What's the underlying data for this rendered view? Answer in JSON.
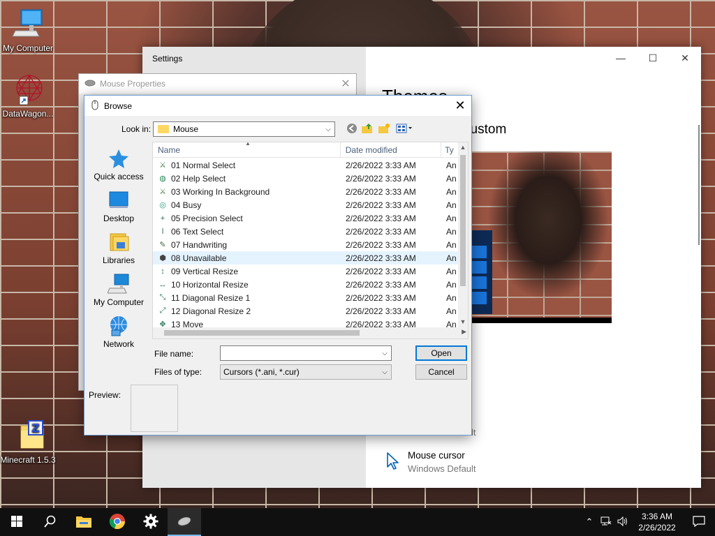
{
  "desktop": {
    "icons": [
      {
        "label": "My Computer",
        "icon": "computer-icon"
      },
      {
        "label": "DataWagon...",
        "icon": "datawagon-shortcut-icon"
      },
      {
        "label": "Minecraft 1.5.3",
        "icon": "minecraft-zip-icon"
      }
    ]
  },
  "settings": {
    "title": "Settings",
    "theme_heading": "Themes",
    "theme_current": "t: Custom",
    "faded_label": "Windows Default",
    "mouse_cursor_title": "Mouse cursor",
    "mouse_cursor_value": "Windows Default"
  },
  "mouse_properties": {
    "title": "Mouse Properties"
  },
  "browse": {
    "title": "Browse",
    "look_in_label": "Look in:",
    "look_in_value": "Mouse",
    "places": [
      {
        "label": "Quick access",
        "icon": "quick-access-star-icon"
      },
      {
        "label": "Desktop",
        "icon": "desktop-icon"
      },
      {
        "label": "Libraries",
        "icon": "libraries-icon"
      },
      {
        "label": "My Computer",
        "icon": "computer-icon"
      },
      {
        "label": "Network",
        "icon": "network-icon"
      }
    ],
    "columns": {
      "name": "Name",
      "date": "Date modified",
      "type": "Ty"
    },
    "files": [
      {
        "name": "01 Normal Select",
        "date": "2/26/2022 3:33 AM",
        "type": "An",
        "icon": "sword-cursor-icon",
        "glyph": "⚔"
      },
      {
        "name": "02 Help Select",
        "date": "2/26/2022 3:33 AM",
        "type": "An",
        "icon": "help-cursor-icon",
        "glyph": "◍"
      },
      {
        "name": "03 Working In Background",
        "date": "2/26/2022 3:33 AM",
        "type": "An",
        "icon": "working-cursor-icon",
        "glyph": "⚔"
      },
      {
        "name": "04 Busy",
        "date": "2/26/2022 3:33 AM",
        "type": "An",
        "icon": "busy-cursor-icon",
        "glyph": "◎"
      },
      {
        "name": "05 Precision Select",
        "date": "2/26/2022 3:33 AM",
        "type": "An",
        "icon": "precision-cursor-icon",
        "glyph": "+"
      },
      {
        "name": "06 Text Select",
        "date": "2/26/2022 3:33 AM",
        "type": "An",
        "icon": "text-cursor-icon",
        "glyph": "ǀ"
      },
      {
        "name": "07 Handwriting",
        "date": "2/26/2022 3:33 AM",
        "type": "An",
        "icon": "handwriting-cursor-icon",
        "glyph": "✎"
      },
      {
        "name": "08 Unavailable",
        "date": "2/26/2022 3:33 AM",
        "type": "An",
        "icon": "unavailable-cursor-icon",
        "glyph": "⬢"
      },
      {
        "name": "09 Vertical Resize",
        "date": "2/26/2022 3:33 AM",
        "type": "An",
        "icon": "vertical-resize-cursor-icon",
        "glyph": "↕"
      },
      {
        "name": "10 Horizontal Resize",
        "date": "2/26/2022 3:33 AM",
        "type": "An",
        "icon": "horizontal-resize-cursor-icon",
        "glyph": "↔"
      },
      {
        "name": "11 Diagonal Resize 1",
        "date": "2/26/2022 3:33 AM",
        "type": "An",
        "icon": "diagonal-resize-1-cursor-icon",
        "glyph": "⤡"
      },
      {
        "name": "12 Diagonal Resize 2",
        "date": "2/26/2022 3:33 AM",
        "type": "An",
        "icon": "diagonal-resize-2-cursor-icon",
        "glyph": "⤢"
      },
      {
        "name": "13 Move",
        "date": "2/26/2022 3:33 AM",
        "type": "An",
        "icon": "move-cursor-icon",
        "glyph": "✥"
      }
    ],
    "selected_index": 7,
    "file_name_label": "File name:",
    "file_name_value": "",
    "files_of_type_label": "Files of type:",
    "files_of_type_value": "Cursors (*.ani, *.cur)",
    "open_label": "Open",
    "cancel_label": "Cancel",
    "preview_label": "Preview:"
  },
  "taskbar": {
    "apps": [
      {
        "name": "start-button",
        "icon": "windows-logo-icon"
      },
      {
        "name": "search-button",
        "icon": "search-icon"
      },
      {
        "name": "file-explorer-button",
        "icon": "folder-icon"
      },
      {
        "name": "chrome-button",
        "icon": "chrome-icon"
      },
      {
        "name": "settings-button",
        "icon": "gear-icon"
      },
      {
        "name": "mouse-properties-button",
        "icon": "mouse-icon"
      }
    ],
    "time": "3:36 AM",
    "date": "2/26/2022"
  }
}
